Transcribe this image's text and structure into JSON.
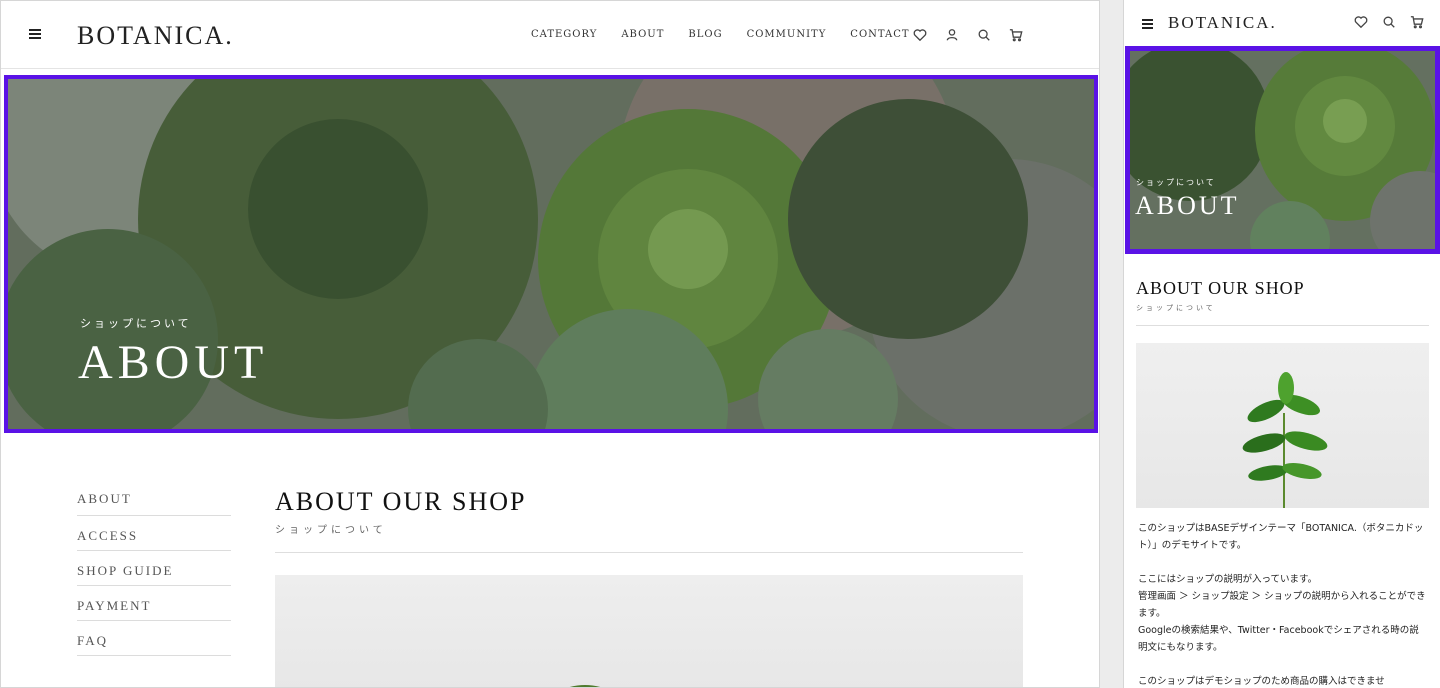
{
  "brand": {
    "logo": "BOTANICA."
  },
  "desktop": {
    "nav": [
      "CATEGORY",
      "ABOUT",
      "BLOG",
      "COMMUNITY",
      "CONTACT"
    ],
    "hero": {
      "sub": "ショップについて",
      "title": "ABOUT"
    },
    "sidebar": [
      "ABOUT",
      "ACCESS",
      "SHOP GUIDE",
      "PAYMENT",
      "FAQ"
    ],
    "main": {
      "title": "ABOUT OUR SHOP",
      "sub": "ショップについて"
    }
  },
  "mobile": {
    "hero": {
      "sub": "ショップについて",
      "title": "ABOUT"
    },
    "main": {
      "title": "ABOUT OUR SHOP",
      "sub": "ショップについて"
    },
    "paragraphs": [
      "このショップはBASEデザインテーマ「BOTANICA.（ボタニカドット）」のデモサイトです。",
      "ここにはショップの説明が入っています。",
      "管理画面 ＞ ショップ設定 ＞ ショップの説明から入れることができます。",
      "Googleの検索結果や、Twitter・Facebookでシェアされる時の説明文にもなります。",
      "このショップはデモショップのため商品の購入はできませ"
    ]
  },
  "icons": [
    "heart-icon",
    "user-icon",
    "search-icon",
    "cart-icon",
    "menu-icon"
  ],
  "colors": {
    "highlight": "#5a12e6",
    "text": "#222222"
  }
}
